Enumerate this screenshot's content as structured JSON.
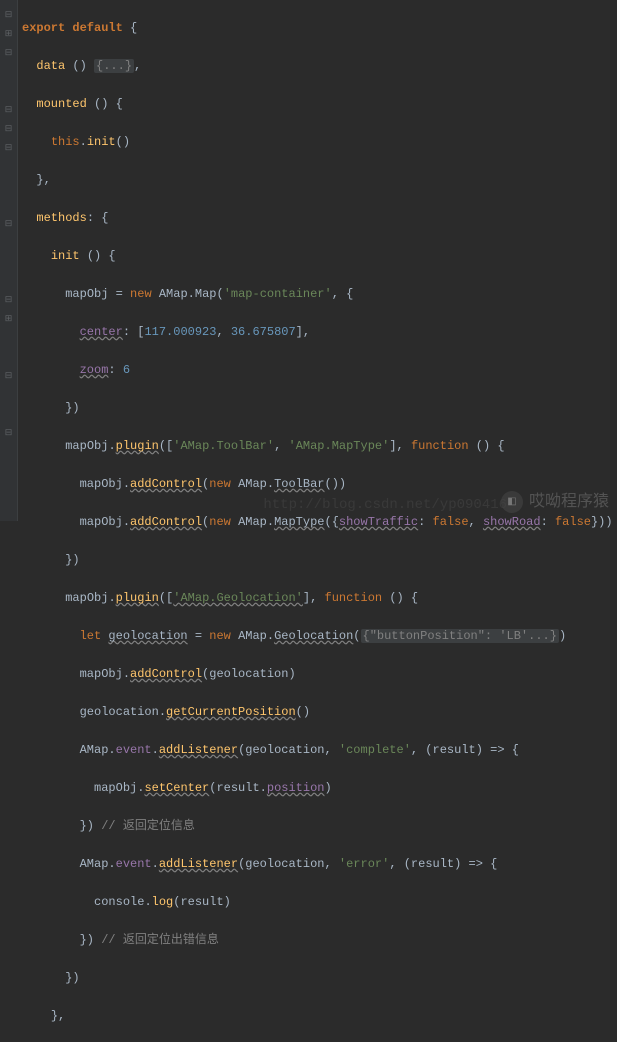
{
  "code": {
    "t1": "export default",
    "t2": "data",
    "t3": "mounted",
    "t4": "this",
    "t5": "init",
    "t6": "methods",
    "t7": "init",
    "t8": "mapObj",
    "t9": "new",
    "t10": "AMap",
    "t11": "Map",
    "t12": "'map-container'",
    "t13": "center",
    "t14": "117.000923",
    "t15": "36.675807",
    "t16": "zoom",
    "t17": "6",
    "t18": "plugin",
    "t19": "'AMap.ToolBar'",
    "t20": "'AMap.MapType'",
    "t21": "function",
    "t22": "addControl",
    "t23": "ToolBar",
    "t24": "MapType",
    "t25": "showTraffic",
    "t26": "false",
    "t27": "showRoad",
    "t28": "'AMap.Geolocation'",
    "t29": "let",
    "t30": "geolocation",
    "t31": "Geolocation",
    "t32": "\"buttonPosition\": 'LB'...",
    "t33": "getCurrentPosition",
    "t34": "event",
    "t35": "addListener",
    "t36": "'complete'",
    "t37": "result",
    "t38": "setCenter",
    "t39": "position",
    "t40": "// 返回定位信息",
    "t41": "'error'",
    "t42": "console",
    "t43": "log",
    "t44": "// 返回定位出错信息",
    "t45": "{...}"
  },
  "watermark": {
    "text": "哎呦程序猿",
    "url": "http://blog.csdn.net/yp090416"
  }
}
